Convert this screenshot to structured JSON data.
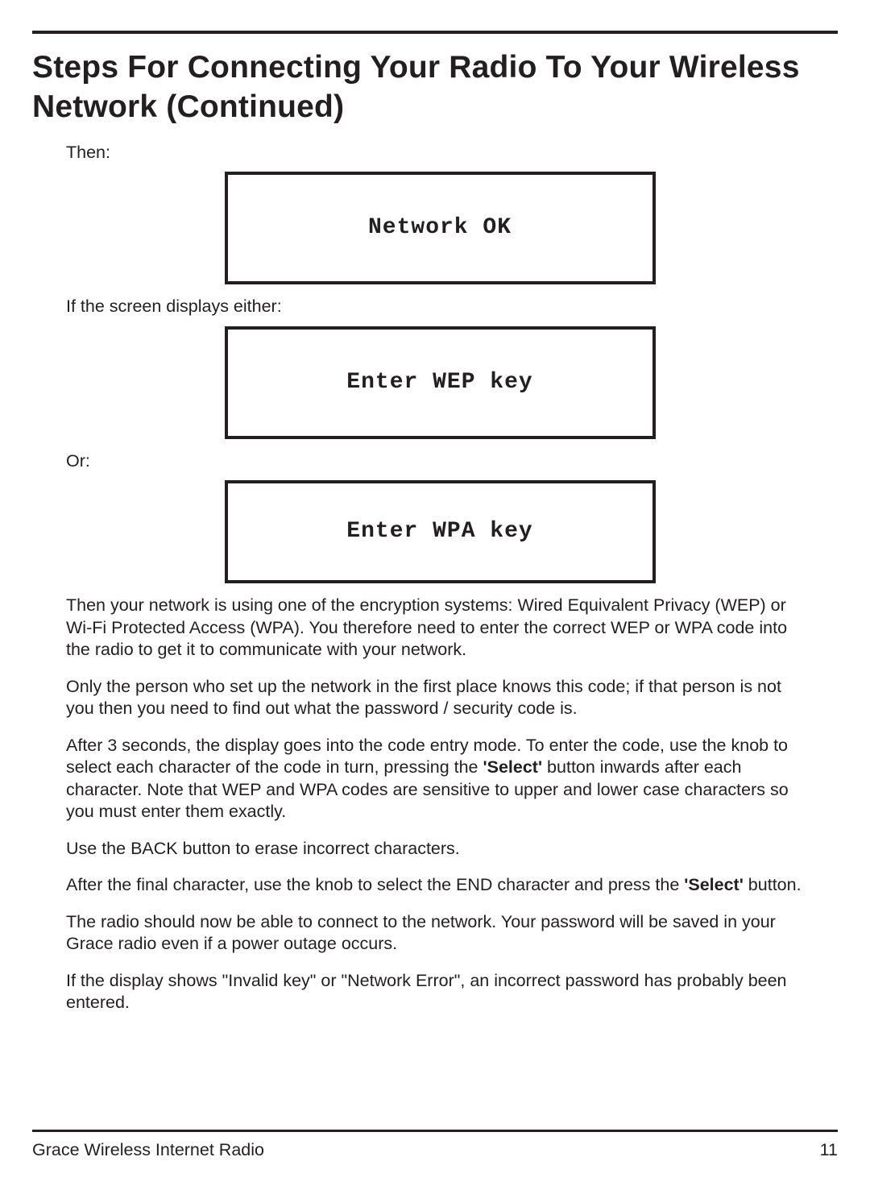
{
  "heading": "Steps For Connecting Your Radio To Your Wireless Network (Continued)",
  "intro_then": "Then:",
  "display1": "Network OK",
  "intro_if": "If the screen displays either:",
  "display2": "Enter WEP key",
  "intro_or": "Or:",
  "display3": "Enter WPA key",
  "para1": "Then your network is using one of the encryption systems:  Wired Equivalent Privacy (WEP) or Wi-Fi Protected Access (WPA). You therefore need to enter the correct WEP or WPA code into the radio to get it to communicate with your network.",
  "para2": "Only the person who set up the network in the first place knows this code; if that person is not you then you need to find out what the password / security code is.",
  "para3a": "After 3 seconds, the display goes into the code entry mode. To enter the code, use the knob to select each character of the code in turn, pressing the ",
  "para3b": "'Select'",
  "para3c": " button inwards after each character. Note that WEP and WPA codes are sensitive to upper and lower case characters so you must enter them exactly.",
  "para4": "Use the BACK button to erase incorrect characters.",
  "para5a": "After the final character, use the knob to select the END character and press the ",
  "para5b": "'Select'",
  "para5c": " button.",
  "para6": "The radio should now be able to connect to the network. Your password will be saved in your Grace radio even if a power outage occurs.",
  "para7": "If the display shows \"Invalid key\" or \"Network Error\", an incorrect password has probably been entered.",
  "footer_left": "Grace Wireless Internet Radio",
  "footer_right": "11"
}
